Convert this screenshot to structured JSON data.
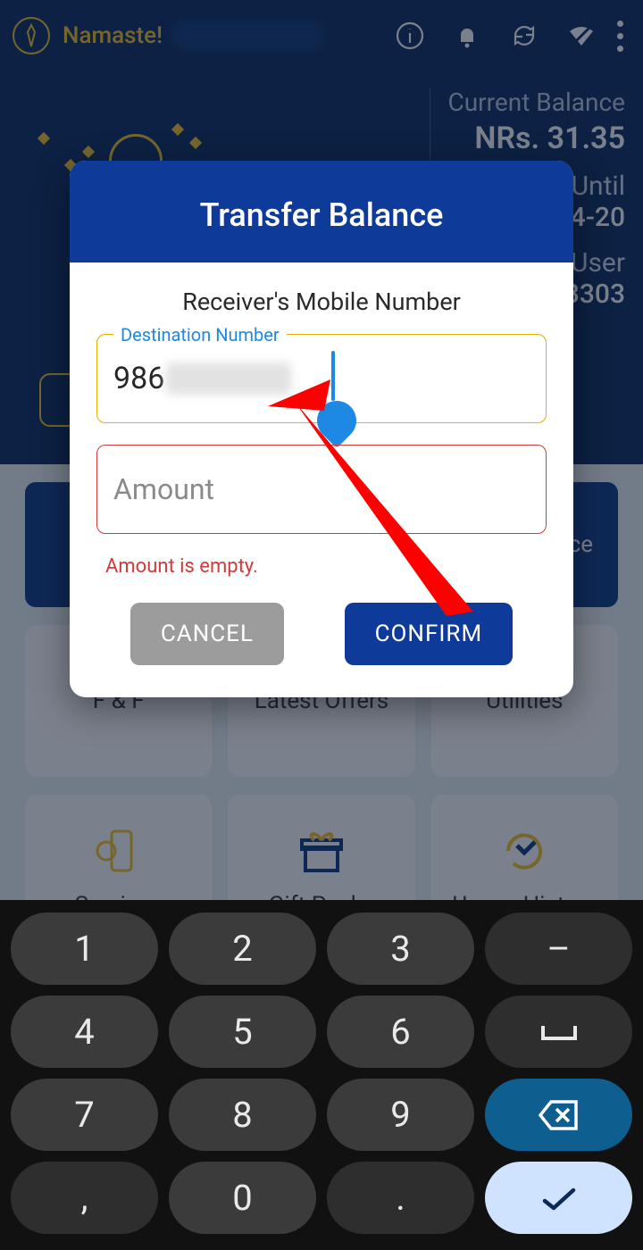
{
  "topbar": {
    "greeting": "Namaste!"
  },
  "hero": {
    "balance_label": "Current Balance",
    "balance_value": "NRs. 31.35",
    "until_label": "Until",
    "until_value": "4-20",
    "user_label": "User",
    "user_value": "3303"
  },
  "bigbar": {
    "right_text": "ce"
  },
  "tiles": {
    "row1": [
      {
        "label": "F & F"
      },
      {
        "label": "Latest Offers"
      },
      {
        "label": "Utilities"
      }
    ],
    "row2": [
      {
        "label": "Services"
      },
      {
        "label": "Gift Packs"
      },
      {
        "label": "Usage History"
      }
    ]
  },
  "modal": {
    "title": "Transfer Balance",
    "section_title": "Receiver's Mobile Number",
    "dest_label": "Destination Number",
    "dest_value_visible": "986",
    "amount_placeholder": "Amount",
    "amount_value": "",
    "error": "Amount is empty.",
    "cancel": "CANCEL",
    "confirm": "CONFIRM"
  },
  "keypad": {
    "k1": "1",
    "k2": "2",
    "k3": "3",
    "k4": "4",
    "k5": "5",
    "k6": "6",
    "k7": "7",
    "k8": "8",
    "k9": "9",
    "kcomma": ",",
    "k0": "0",
    "kdot": ".",
    "kminus": "–"
  }
}
